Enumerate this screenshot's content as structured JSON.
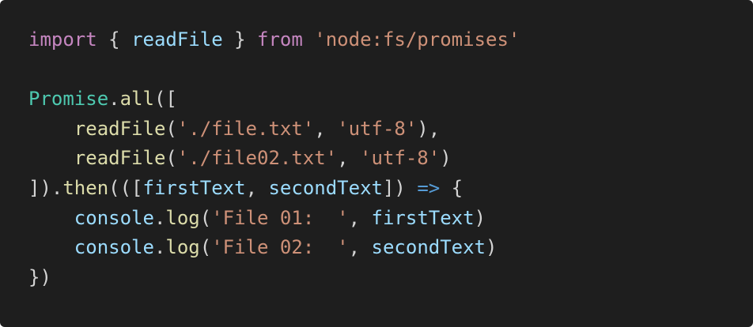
{
  "code": {
    "line1": {
      "kw_import": "import",
      "brace_open": " { ",
      "ident": "readFile",
      "brace_close": " } ",
      "kw_from": "from",
      "space": " ",
      "module": "'node:fs/promises'"
    },
    "line3": {
      "promise": "Promise",
      "dot": ".",
      "all": "all",
      "open": "(["
    },
    "line4": {
      "indent": "    ",
      "fn": "readFile",
      "paren": "(",
      "path": "'./file.txt'",
      "comma": ", ",
      "enc": "'utf-8'",
      "close": "),"
    },
    "line5": {
      "indent": "    ",
      "fn": "readFile",
      "paren": "(",
      "path": "'./file02.txt'",
      "comma": ", ",
      "enc": "'utf-8'",
      "close": ")"
    },
    "line6": {
      "close": "]).",
      "then": "then",
      "open": "(([",
      "p1": "firstText",
      "comma": ", ",
      "p2": "secondText",
      "close2": "]) ",
      "arrow": "=>",
      "brace": " {"
    },
    "line7": {
      "indent": "    ",
      "obj": "console",
      "dot": ".",
      "fn": "log",
      "paren": "(",
      "str": "'File 01:  '",
      "comma": ", ",
      "arg": "firstText",
      "close": ")"
    },
    "line8": {
      "indent": "    ",
      "obj": "console",
      "dot": ".",
      "fn": "log",
      "paren": "(",
      "str": "'File 02:  '",
      "comma": ", ",
      "arg": "secondText",
      "close": ")"
    },
    "line9": {
      "close": "})"
    }
  },
  "colors": {
    "background": "#1e1e1e",
    "keyword": "#c586c0",
    "variable": "#9cdcfe",
    "string": "#ce9178",
    "class": "#4ec9b0",
    "function": "#dcdcaa",
    "arrow": "#569cd6",
    "punctuation": "#d4d4d4"
  }
}
